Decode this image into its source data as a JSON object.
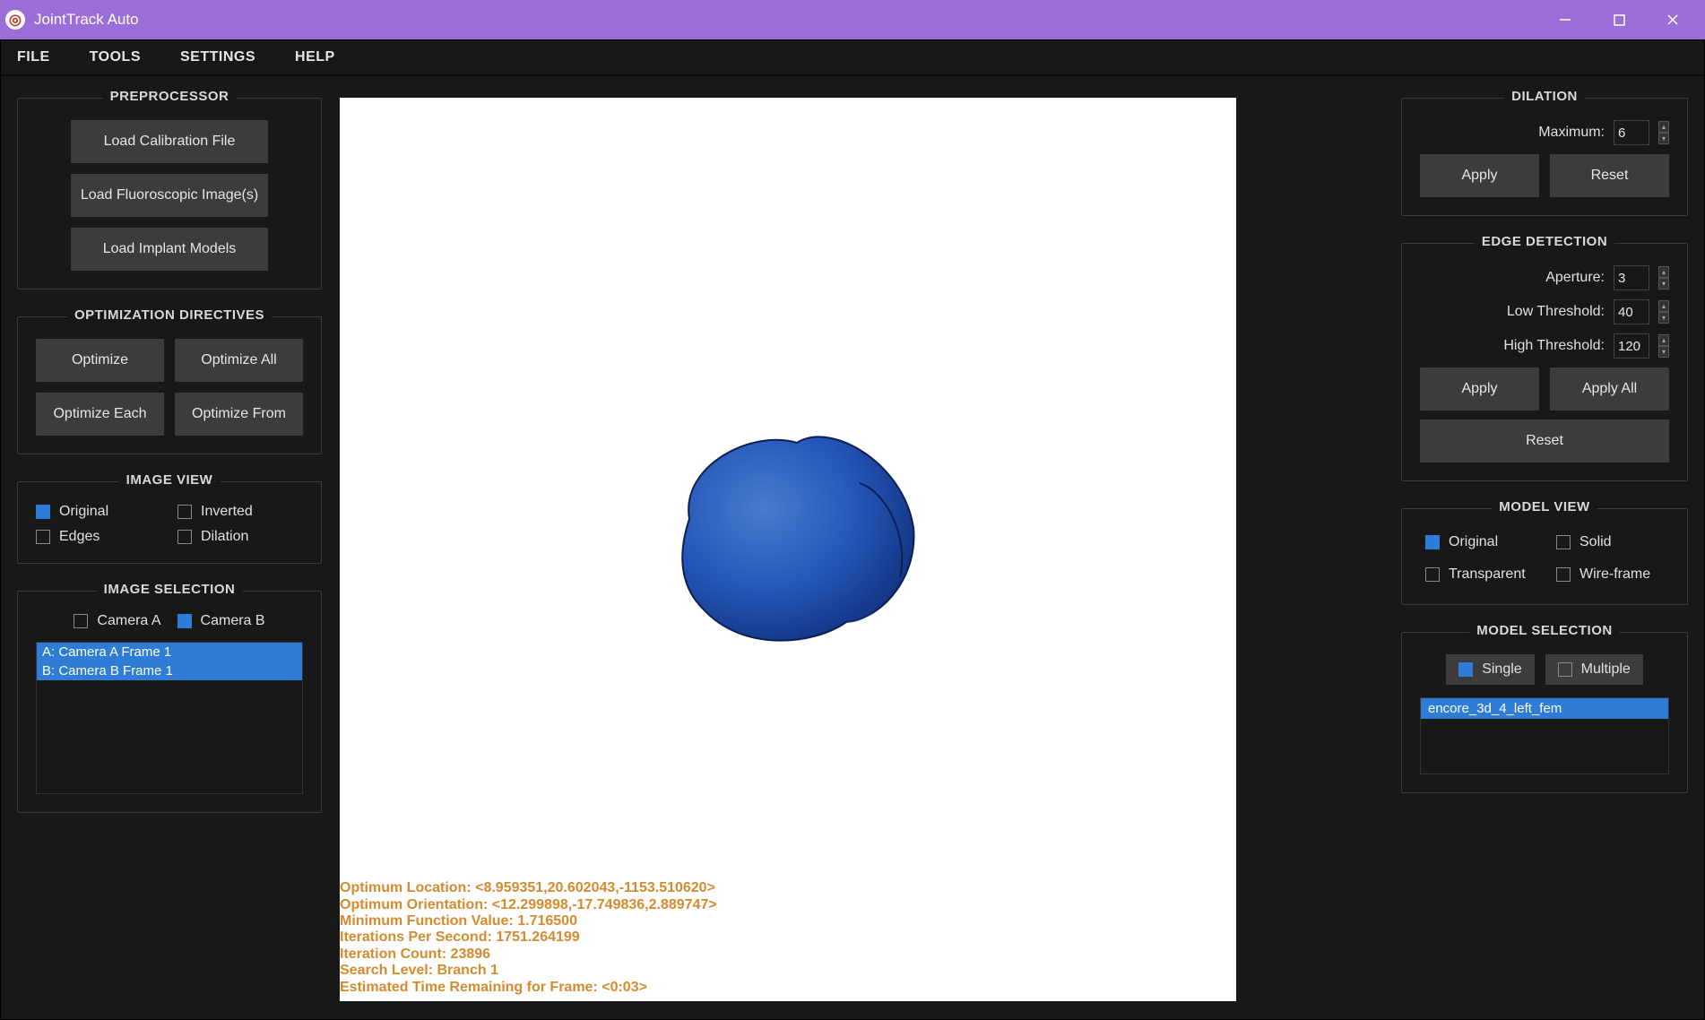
{
  "window": {
    "title": "JointTrack Auto"
  },
  "menu": {
    "file": "FILE",
    "tools": "TOOLS",
    "settings": "SETTINGS",
    "help": "HELP"
  },
  "preprocessor": {
    "title": "PREPROCESSOR",
    "load_calibration": "Load Calibration File",
    "load_fluoro": "Load Fluoroscopic Image(s)",
    "load_implant": "Load Implant Models"
  },
  "optimization": {
    "title": "OPTIMIZATION DIRECTIVES",
    "optimize": "Optimize",
    "optimize_all": "Optimize All",
    "optimize_each": "Optimize Each",
    "optimize_from": "Optimize From"
  },
  "image_view": {
    "title": "IMAGE VIEW",
    "original": "Original",
    "inverted": "Inverted",
    "edges": "Edges",
    "dilation": "Dilation"
  },
  "image_selection": {
    "title": "IMAGE SELECTION",
    "camera_a": "Camera A",
    "camera_b": "Camera B",
    "items": [
      "A: Camera A Frame 1",
      "B: Camera B Frame 1"
    ]
  },
  "overlay": {
    "l1": "Optimum Location: <8.959351,20.602043,-1153.510620>",
    "l2": "Optimum Orientation: <12.299898,-17.749836,2.889747>",
    "l3": "Minimum Function Value: 1.716500",
    "l4": "Iterations Per Second: 1751.264199",
    "l5": "Iteration Count: 23896",
    "l6": "Search Level: Branch 1",
    "l7": "Estimated Time Remaining for Frame: <0:03>"
  },
  "dilation": {
    "title": "DILATION",
    "maximum_label": "Maximum:",
    "maximum": "6",
    "apply": "Apply",
    "reset": "Reset"
  },
  "edge": {
    "title": "EDGE DETECTION",
    "aperture_label": "Aperture:",
    "aperture": "3",
    "low_label": "Low Threshold:",
    "low": "40",
    "high_label": "High Threshold:",
    "high": "120",
    "apply": "Apply",
    "apply_all": "Apply All",
    "reset": "Reset"
  },
  "model_view": {
    "title": "MODEL VIEW",
    "original": "Original",
    "solid": "Solid",
    "transparent": "Transparent",
    "wireframe": "Wire-frame"
  },
  "model_selection": {
    "title": "MODEL SELECTION",
    "single": "Single",
    "multiple": "Multiple",
    "items": [
      "encore_3d_4_left_fem"
    ]
  }
}
